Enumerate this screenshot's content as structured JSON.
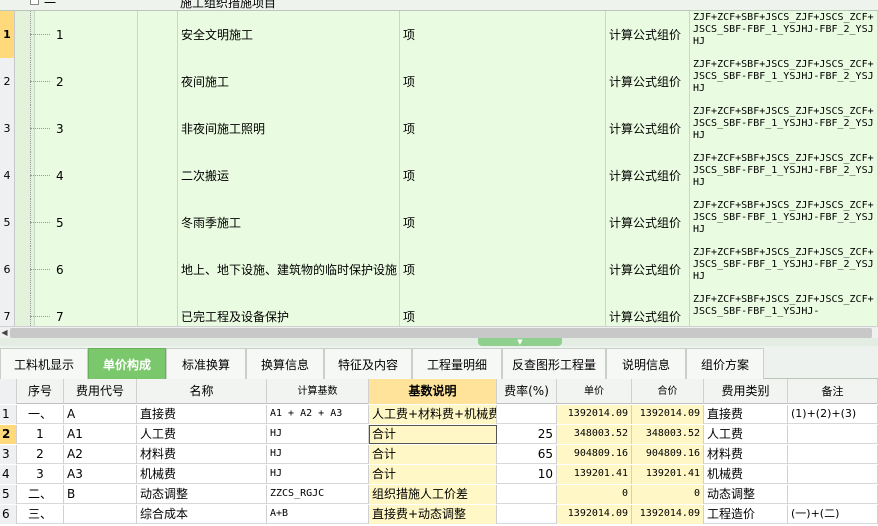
{
  "top_grid": {
    "header_row": {
      "code": "一",
      "name": "施工组织措施项目"
    },
    "rows": [
      {
        "rownum": "1",
        "seq": "1",
        "name": "安全文明施工",
        "unit": "项",
        "method": "计算公式组价",
        "formula": "ZJF+ZCF+SBF+JSCS_ZJF+JSCS_ZCF+JSCS_SBF-FBF_1_YSJHJ-FBF_2_YSJHJ"
      },
      {
        "rownum": "2",
        "seq": "2",
        "name": "夜间施工",
        "unit": "项",
        "method": "计算公式组价",
        "formula": "ZJF+ZCF+SBF+JSCS_ZJF+JSCS_ZCF+JSCS_SBF-FBF_1_YSJHJ-FBF_2_YSJHJ"
      },
      {
        "rownum": "3",
        "seq": "3",
        "name": "非夜间施工照明",
        "unit": "项",
        "method": "计算公式组价",
        "formula": "ZJF+ZCF+SBF+JSCS_ZJF+JSCS_ZCF+JSCS_SBF-FBF_1_YSJHJ-FBF_2_YSJHJ"
      },
      {
        "rownum": "4",
        "seq": "4",
        "name": "二次搬运",
        "unit": "项",
        "method": "计算公式组价",
        "formula": "ZJF+ZCF+SBF+JSCS_ZJF+JSCS_ZCF+JSCS_SBF-FBF_1_YSJHJ-FBF_2_YSJHJ"
      },
      {
        "rownum": "5",
        "seq": "5",
        "name": "冬雨季施工",
        "unit": "项",
        "method": "计算公式组价",
        "formula": "ZJF+ZCF+SBF+JSCS_ZJF+JSCS_ZCF+JSCS_SBF-FBF_1_YSJHJ-FBF_2_YSJHJ"
      },
      {
        "rownum": "6",
        "seq": "6",
        "name": "地上、地下设施、建筑物的临时保护设施",
        "unit": "项",
        "method": "计算公式组价",
        "formula": "ZJF+ZCF+SBF+JSCS_ZJF+JSCS_ZCF+JSCS_SBF-FBF_1_YSJHJ-FBF_2_YSJHJ"
      },
      {
        "rownum": "7",
        "seq": "7",
        "name": "已完工程及设备保护",
        "unit": "项",
        "method": "计算公式组价",
        "formula": "ZJF+ZCF+SBF+JSCS_ZJF+JSCS_ZCF+JSCS_SBF-FBF_1_YSJHJ-"
      }
    ]
  },
  "tabs": [
    "工料机显示",
    "单价构成",
    "标准换算",
    "换算信息",
    "特征及内容",
    "工程量明细",
    "反查图形工程量",
    "说明信息",
    "组价方案"
  ],
  "active_tab": "单价构成",
  "bottom_grid": {
    "headers": [
      "序号",
      "费用代号",
      "名称",
      "计算基数",
      "基数说明",
      "费率(%)",
      "单价",
      "合价",
      "费用类别",
      "备注"
    ],
    "rows": [
      {
        "n": "1",
        "seq": "一、",
        "code": "A",
        "name": "直接费",
        "base": "A1 + A2 + A3",
        "desc": "人工费+材料费+机械费",
        "rate": "",
        "price": "1392014.09",
        "total": "1392014.09",
        "cat": "直接费",
        "note": "(1)+(2)+(3)"
      },
      {
        "n": "2",
        "seq": "1",
        "code": "A1",
        "name": "人工费",
        "base": "HJ",
        "desc": "合计",
        "rate": "25",
        "price": "348003.52",
        "total": "348003.52",
        "cat": "人工费",
        "note": ""
      },
      {
        "n": "3",
        "seq": "2",
        "code": "A2",
        "name": "材料费",
        "base": "HJ",
        "desc": "合计",
        "rate": "65",
        "price": "904809.16",
        "total": "904809.16",
        "cat": "材料费",
        "note": ""
      },
      {
        "n": "4",
        "seq": "3",
        "code": "A3",
        "name": "机械费",
        "base": "HJ",
        "desc": "合计",
        "rate": "10",
        "price": "139201.41",
        "total": "139201.41",
        "cat": "机械费",
        "note": ""
      },
      {
        "n": "5",
        "seq": "二、",
        "code": "B",
        "name": "动态调整",
        "base": "ZZCS_RGJC",
        "desc": "组织措施人工价差",
        "rate": "",
        "price": "0",
        "total": "0",
        "cat": "动态调整",
        "note": ""
      },
      {
        "n": "6",
        "seq": "三、",
        "code": "",
        "name": "综合成本",
        "base": "A+B",
        "desc": "直接费+动态调整",
        "rate": "",
        "price": "1392014.09",
        "total": "1392014.09",
        "cat": "工程造价",
        "note": "(一)+(二)"
      }
    ]
  },
  "selected_top_row": "1",
  "selected_bottom_row": "2"
}
